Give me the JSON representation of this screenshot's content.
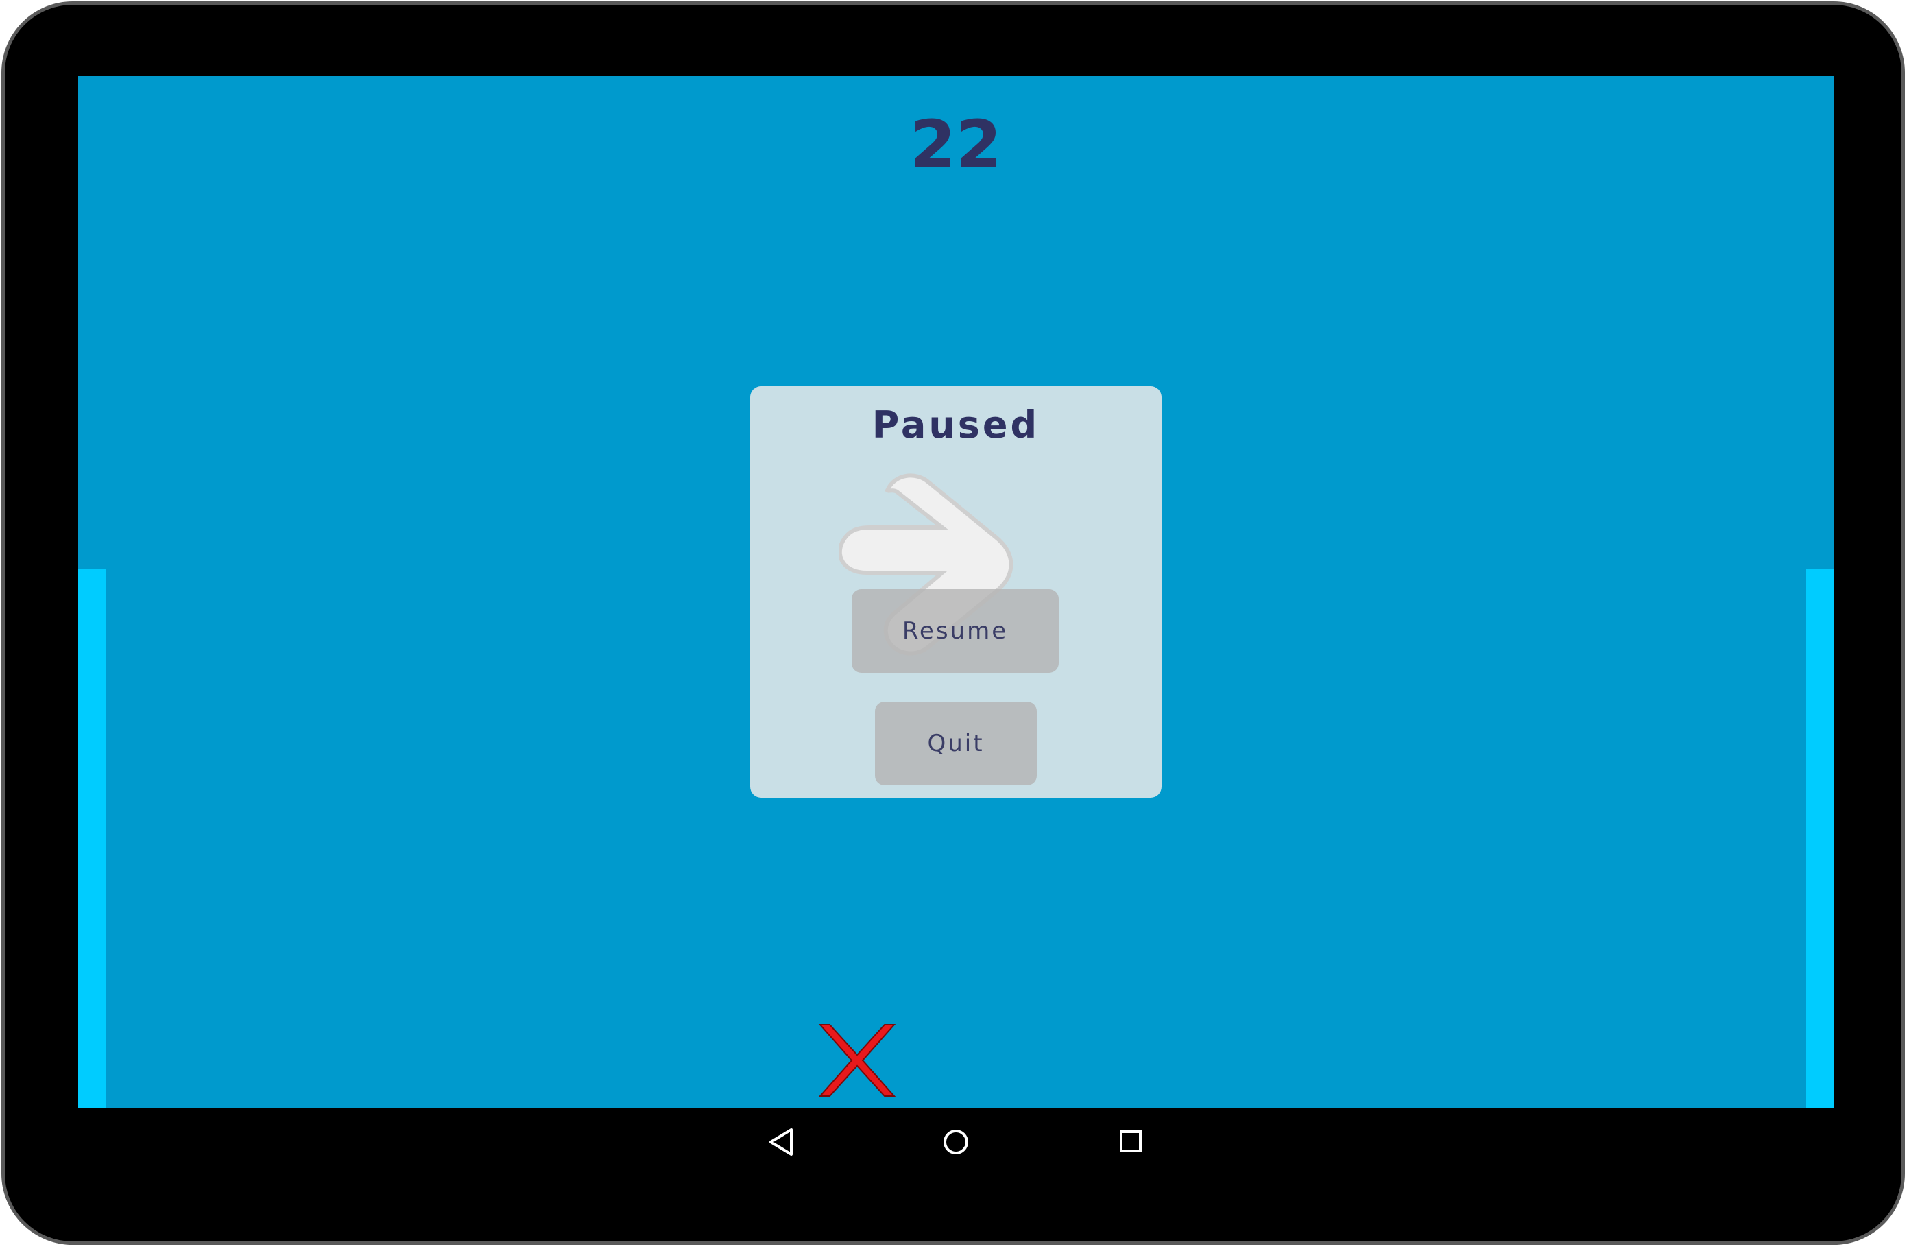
{
  "game": {
    "score": "22"
  },
  "pause_menu": {
    "title": "Paused",
    "resume_label": "Resume",
    "quit_label": "Quit"
  },
  "colors": {
    "background": "#009acd",
    "paddle": "#00ccff",
    "text": "#2f3263",
    "panel": "#c9dfe6",
    "miss_marker": "#e8191c"
  },
  "icons": {
    "resume_graphic": "right-arrow-icon",
    "miss_marker": "red-x-icon",
    "nav_back": "back-triangle-icon",
    "nav_home": "home-circle-icon",
    "nav_recents": "recents-square-icon"
  }
}
